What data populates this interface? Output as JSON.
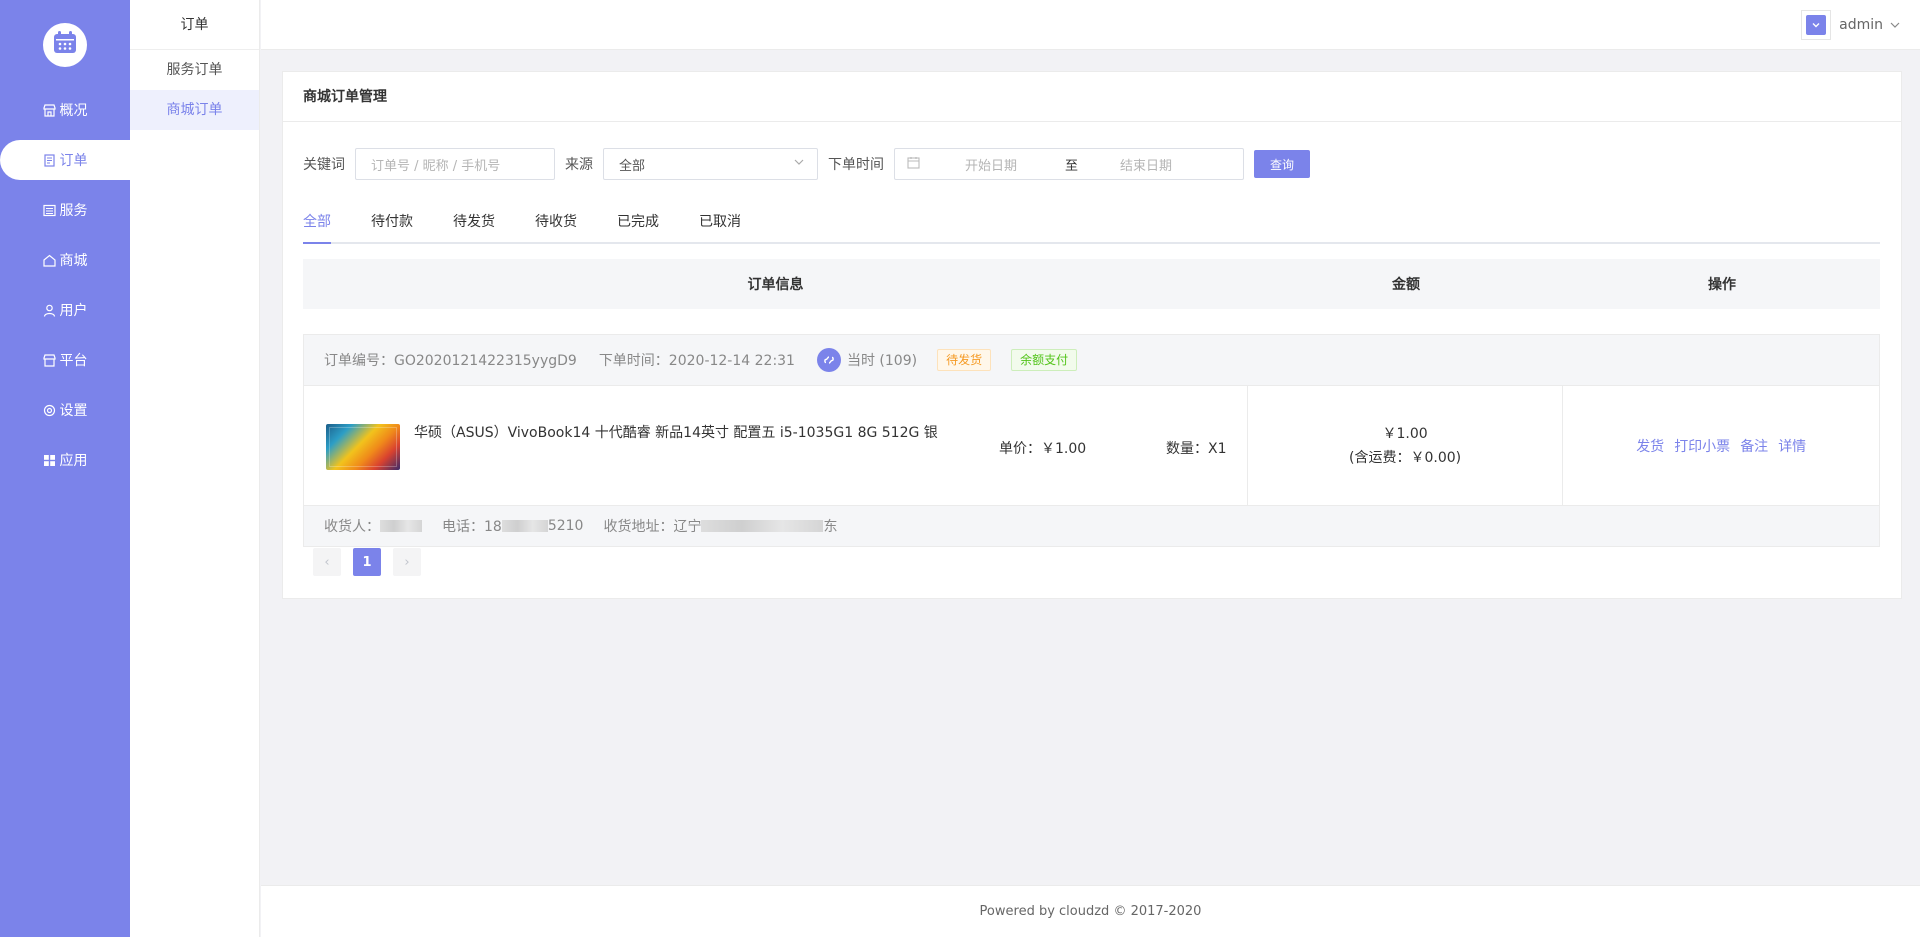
{
  "sidebar": {
    "logo_icon": "calendar-icon",
    "items": [
      {
        "label": "概况",
        "icon": "shop-icon"
      },
      {
        "label": "订单",
        "icon": "document-icon"
      },
      {
        "label": "服务",
        "icon": "list-icon"
      },
      {
        "label": "商城",
        "icon": "home-icon"
      },
      {
        "label": "用户",
        "icon": "user-icon"
      },
      {
        "label": "平台",
        "icon": "store-icon"
      },
      {
        "label": "设置",
        "icon": "settings-icon"
      },
      {
        "label": "应用",
        "icon": "apps-icon"
      }
    ],
    "active_index": 1
  },
  "subnav": {
    "title": "订单",
    "items": [
      {
        "label": "服务订单"
      },
      {
        "label": "商城订单"
      }
    ],
    "active_index": 1
  },
  "header": {
    "username": "admin"
  },
  "card": {
    "title": "商城订单管理"
  },
  "filters": {
    "keyword_label": "关键词",
    "keyword_placeholder": "订单号 / 昵称 / 手机号",
    "source_label": "来源",
    "source_value": "全部",
    "time_label": "下单时间",
    "start_placeholder": "开始日期",
    "separator": "至",
    "end_placeholder": "结束日期",
    "query_label": "查询"
  },
  "tabs": [
    {
      "label": "全部"
    },
    {
      "label": "待付款"
    },
    {
      "label": "待发货"
    },
    {
      "label": "待收货"
    },
    {
      "label": "已完成"
    },
    {
      "label": "已取消"
    }
  ],
  "table": {
    "col_info": "订单信息",
    "col_amount": "金额",
    "col_op": "操作"
  },
  "order": {
    "number_text": "订单编号：GO2020121422315yygD9",
    "time_text": "下单时间：2020-12-14 22:31",
    "source_text": "当时 (109)",
    "status_tag": "待发货",
    "pay_tag": "余额支付",
    "product_name": "华硕（ASUS）VivoBook14 十代酷睿 新品14英寸 配置五 i5-1035G1 8G 512G 银",
    "unit_price": "单价：￥1.00",
    "quantity": "数量：X1",
    "amount": "￥1.00",
    "shipping": "(含运费：￥0.00)",
    "actions": [
      {
        "label": "发货"
      },
      {
        "label": "打印小票"
      },
      {
        "label": "备注"
      },
      {
        "label": "详情"
      }
    ],
    "receiver_label": "收货人：",
    "phone_prefix": "电话：18",
    "phone_suffix": "5210",
    "address_label": "收货地址：辽宁",
    "address_suffix": "东"
  },
  "pagination": {
    "prev": "‹",
    "current": "1",
    "next": "›"
  },
  "footer": {
    "text": "Powered by cloudzd © 2017-2020"
  },
  "colors": {
    "primary": "#7b83ea",
    "sidebar_bg": "#7b83ea",
    "tag_orange": "#f59a23",
    "tag_green": "#52c41a"
  }
}
